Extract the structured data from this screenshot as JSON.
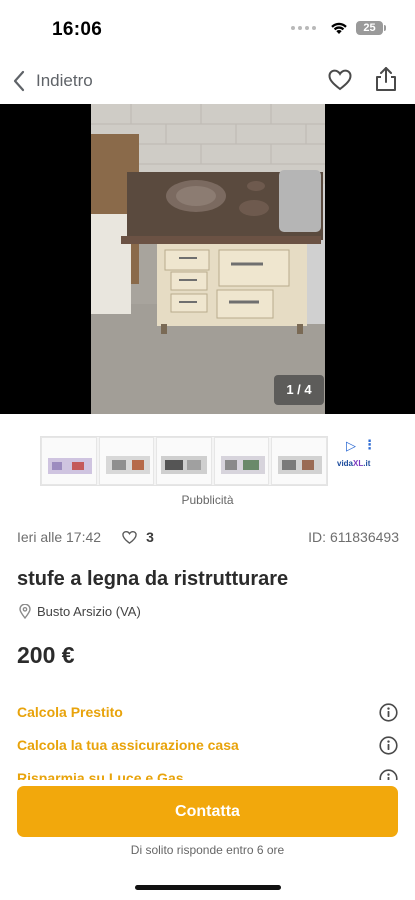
{
  "status_bar": {
    "time": "16:06",
    "battery": "25"
  },
  "nav": {
    "back_label": "Indietro"
  },
  "gallery": {
    "counter": "1 / 4"
  },
  "ad": {
    "label": "Pubblicità",
    "logo_prefix": "vida",
    "logo_highlight": "XL",
    "logo_suffix": ".it"
  },
  "listing": {
    "date": "Ieri alle 17:42",
    "likes": "3",
    "id": "ID: 611836493",
    "title": "stufe a legna da ristrutturare",
    "location": "Busto Arsizio (VA)",
    "price": "200 €"
  },
  "links": [
    {
      "label": "Calcola Prestito"
    },
    {
      "label": "Calcola la tua assicurazione casa"
    },
    {
      "label": "Risparmia su Luce e Gas"
    }
  ],
  "contact": {
    "button_label": "Contatta",
    "response_note": "Di solito risponde entro 6 ore"
  },
  "colors": {
    "accent": "#f2a80c",
    "link_accent": "#e8a30b",
    "text_dark": "#2b2b2b"
  }
}
